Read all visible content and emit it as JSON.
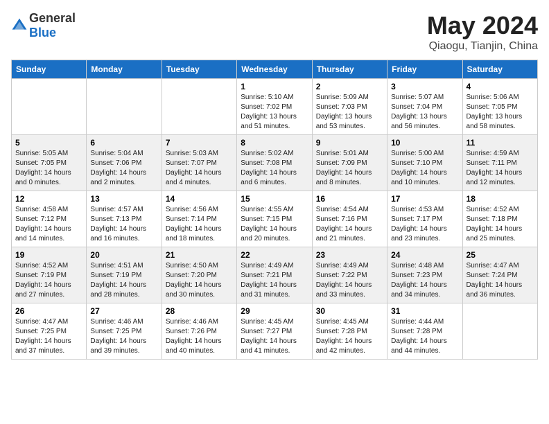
{
  "header": {
    "logo_general": "General",
    "logo_blue": "Blue",
    "title": "May 2024",
    "location": "Qiaogu, Tianjin, China"
  },
  "days_of_week": [
    "Sunday",
    "Monday",
    "Tuesday",
    "Wednesday",
    "Thursday",
    "Friday",
    "Saturday"
  ],
  "weeks": [
    [
      {
        "day": "",
        "info": ""
      },
      {
        "day": "",
        "info": ""
      },
      {
        "day": "",
        "info": ""
      },
      {
        "day": "1",
        "info": "Sunrise: 5:10 AM\nSunset: 7:02 PM\nDaylight: 13 hours\nand 51 minutes."
      },
      {
        "day": "2",
        "info": "Sunrise: 5:09 AM\nSunset: 7:03 PM\nDaylight: 13 hours\nand 53 minutes."
      },
      {
        "day": "3",
        "info": "Sunrise: 5:07 AM\nSunset: 7:04 PM\nDaylight: 13 hours\nand 56 minutes."
      },
      {
        "day": "4",
        "info": "Sunrise: 5:06 AM\nSunset: 7:05 PM\nDaylight: 13 hours\nand 58 minutes."
      }
    ],
    [
      {
        "day": "5",
        "info": "Sunrise: 5:05 AM\nSunset: 7:05 PM\nDaylight: 14 hours\nand 0 minutes."
      },
      {
        "day": "6",
        "info": "Sunrise: 5:04 AM\nSunset: 7:06 PM\nDaylight: 14 hours\nand 2 minutes."
      },
      {
        "day": "7",
        "info": "Sunrise: 5:03 AM\nSunset: 7:07 PM\nDaylight: 14 hours\nand 4 minutes."
      },
      {
        "day": "8",
        "info": "Sunrise: 5:02 AM\nSunset: 7:08 PM\nDaylight: 14 hours\nand 6 minutes."
      },
      {
        "day": "9",
        "info": "Sunrise: 5:01 AM\nSunset: 7:09 PM\nDaylight: 14 hours\nand 8 minutes."
      },
      {
        "day": "10",
        "info": "Sunrise: 5:00 AM\nSunset: 7:10 PM\nDaylight: 14 hours\nand 10 minutes."
      },
      {
        "day": "11",
        "info": "Sunrise: 4:59 AM\nSunset: 7:11 PM\nDaylight: 14 hours\nand 12 minutes."
      }
    ],
    [
      {
        "day": "12",
        "info": "Sunrise: 4:58 AM\nSunset: 7:12 PM\nDaylight: 14 hours\nand 14 minutes."
      },
      {
        "day": "13",
        "info": "Sunrise: 4:57 AM\nSunset: 7:13 PM\nDaylight: 14 hours\nand 16 minutes."
      },
      {
        "day": "14",
        "info": "Sunrise: 4:56 AM\nSunset: 7:14 PM\nDaylight: 14 hours\nand 18 minutes."
      },
      {
        "day": "15",
        "info": "Sunrise: 4:55 AM\nSunset: 7:15 PM\nDaylight: 14 hours\nand 20 minutes."
      },
      {
        "day": "16",
        "info": "Sunrise: 4:54 AM\nSunset: 7:16 PM\nDaylight: 14 hours\nand 21 minutes."
      },
      {
        "day": "17",
        "info": "Sunrise: 4:53 AM\nSunset: 7:17 PM\nDaylight: 14 hours\nand 23 minutes."
      },
      {
        "day": "18",
        "info": "Sunrise: 4:52 AM\nSunset: 7:18 PM\nDaylight: 14 hours\nand 25 minutes."
      }
    ],
    [
      {
        "day": "19",
        "info": "Sunrise: 4:52 AM\nSunset: 7:19 PM\nDaylight: 14 hours\nand 27 minutes."
      },
      {
        "day": "20",
        "info": "Sunrise: 4:51 AM\nSunset: 7:19 PM\nDaylight: 14 hours\nand 28 minutes."
      },
      {
        "day": "21",
        "info": "Sunrise: 4:50 AM\nSunset: 7:20 PM\nDaylight: 14 hours\nand 30 minutes."
      },
      {
        "day": "22",
        "info": "Sunrise: 4:49 AM\nSunset: 7:21 PM\nDaylight: 14 hours\nand 31 minutes."
      },
      {
        "day": "23",
        "info": "Sunrise: 4:49 AM\nSunset: 7:22 PM\nDaylight: 14 hours\nand 33 minutes."
      },
      {
        "day": "24",
        "info": "Sunrise: 4:48 AM\nSunset: 7:23 PM\nDaylight: 14 hours\nand 34 minutes."
      },
      {
        "day": "25",
        "info": "Sunrise: 4:47 AM\nSunset: 7:24 PM\nDaylight: 14 hours\nand 36 minutes."
      }
    ],
    [
      {
        "day": "26",
        "info": "Sunrise: 4:47 AM\nSunset: 7:25 PM\nDaylight: 14 hours\nand 37 minutes."
      },
      {
        "day": "27",
        "info": "Sunrise: 4:46 AM\nSunset: 7:25 PM\nDaylight: 14 hours\nand 39 minutes."
      },
      {
        "day": "28",
        "info": "Sunrise: 4:46 AM\nSunset: 7:26 PM\nDaylight: 14 hours\nand 40 minutes."
      },
      {
        "day": "29",
        "info": "Sunrise: 4:45 AM\nSunset: 7:27 PM\nDaylight: 14 hours\nand 41 minutes."
      },
      {
        "day": "30",
        "info": "Sunrise: 4:45 AM\nSunset: 7:28 PM\nDaylight: 14 hours\nand 42 minutes."
      },
      {
        "day": "31",
        "info": "Sunrise: 4:44 AM\nSunset: 7:28 PM\nDaylight: 14 hours\nand 44 minutes."
      },
      {
        "day": "",
        "info": ""
      }
    ]
  ]
}
